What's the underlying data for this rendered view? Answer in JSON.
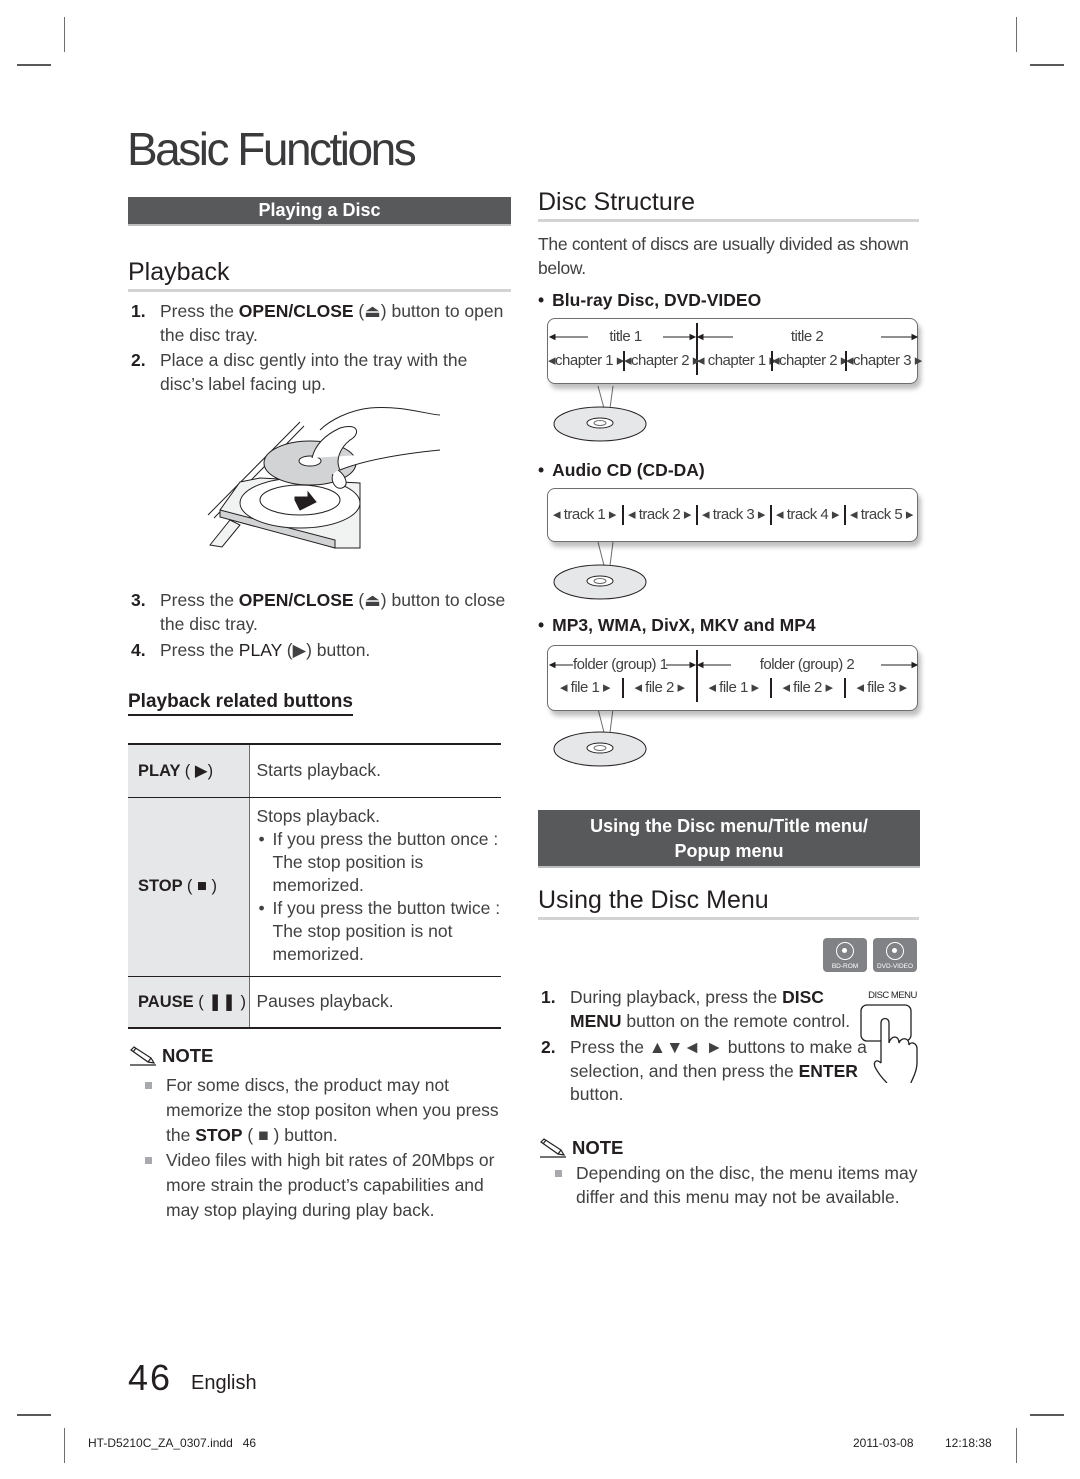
{
  "page": {
    "title": "Basic Functions",
    "page_number": "46",
    "language": "English",
    "footer": {
      "file": "HT-D5210C_ZA_0307.indd   46",
      "date": "2011-03-08",
      "time": "12:18:38"
    }
  },
  "left": {
    "band": "Playing a Disc",
    "heading": "Playback",
    "steps_a": [
      {
        "num": "1.",
        "pre": "Press the ",
        "bold": "OPEN/CLOSE",
        "post": " (⏏) button to open the disc tray."
      },
      {
        "num": "2.",
        "pre": "Place a disc gently into the tray with the disc’s label facing up.",
        "bold": "",
        "post": ""
      }
    ],
    "steps_b": [
      {
        "num": "3.",
        "pre": "Press the ",
        "bold": "OPEN/CLOSE",
        "post": " (⏏) button to close the disc tray."
      },
      {
        "num": "4.",
        "pre": "Press the ",
        "bold": "PLAY",
        "post": " (▶) button."
      }
    ],
    "subheading": "Playback related buttons",
    "table": [
      {
        "key": "PLAY",
        "glyph": "( ▶)",
        "desc": "Starts playback.",
        "bullets": []
      },
      {
        "key": "STOP",
        "glyph": "( ■ )",
        "desc": "Stops playback.",
        "bullets": [
          "If you press the button once : The stop position is memorized.",
          "If you press the button twice : The stop position is not memorized."
        ]
      },
      {
        "key": "PAUSE",
        "glyph": "( ❚❚ )",
        "desc": "Pauses playback.",
        "bullets": []
      }
    ],
    "note": {
      "label": "NOTE",
      "items": [
        {
          "pre": "For some discs, the product may not memorize the stop positon when you press the ",
          "bold": "STOP",
          "post": " ( ■ ) button."
        },
        {
          "pre": "Video files with high bit rates of 20Mbps or more strain the product’s capabilities and may stop playing during play back.",
          "bold": "",
          "post": ""
        }
      ]
    }
  },
  "right": {
    "heading_structure": "Disc Structure",
    "intro": "The content of discs are usually divided as shown below.",
    "disc_types": [
      {
        "label": "Blu-ray Disc, DVD-VIDEO",
        "top_row": [
          "title 1",
          "title 2"
        ],
        "bottom_row": [
          "chapter 1",
          "chapter 2",
          "chapter 1",
          "chapter 2",
          "chapter 3"
        ]
      },
      {
        "label": "Audio CD (CD-DA)",
        "top_row": [],
        "bottom_row": [
          "track 1",
          "track 2",
          "track 3",
          "track 4",
          "track 5"
        ]
      },
      {
        "label": "MP3, WMA, DivX, MKV and MP4",
        "top_row": [
          "folder (group) 1",
          "folder (group) 2"
        ],
        "bottom_row": [
          "file 1",
          "file 2",
          "file 1",
          "file 2",
          "file 3"
        ]
      }
    ],
    "band": "Using the Disc menu/Title menu/ Popup menu",
    "band_line1": "Using the Disc menu/Title menu/",
    "band_line2": "Popup menu",
    "heading_menu": "Using the Disc Menu",
    "disc_icons": [
      "BD-ROM",
      "DVD-VIDEO"
    ],
    "remote_label": "DISC MENU",
    "steps": [
      {
        "num": "1.",
        "pre": "During playback, press the ",
        "bold": "DISC MENU",
        "post": "  button on the remote control."
      },
      {
        "num": "2.",
        "pre": "Press the ▲▼◄ ► buttons to make a selection, and then press the ",
        "bold": "ENTER",
        "post": " button."
      }
    ],
    "note": {
      "label": "NOTE",
      "items": [
        {
          "pre": "Depending on the disc, the menu items may differ and this menu may not be available.",
          "bold": "",
          "post": ""
        }
      ]
    }
  },
  "colors": {
    "band_bg": "#58595b",
    "heading_rule": "#d1d3d4",
    "table_key_bg": "#e6e7e8",
    "text": "#231f20",
    "body_text": "#414042"
  }
}
